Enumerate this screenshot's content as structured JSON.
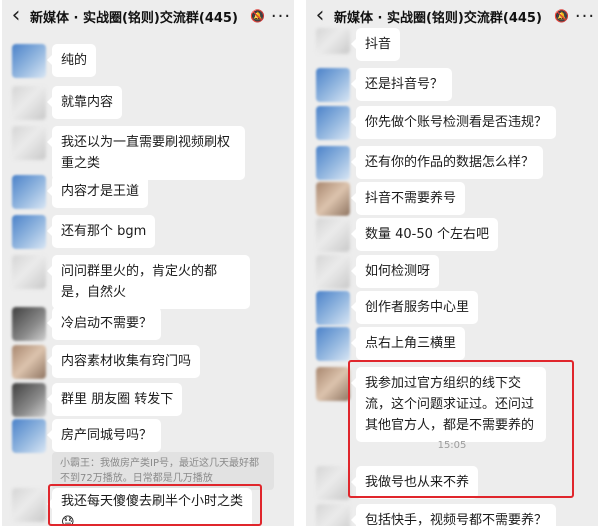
{
  "icons": {
    "back": "‹",
    "bell": "🔕",
    "more": "···"
  },
  "colors": {
    "highlight": "#e0262c",
    "chat_bg": "#ededed",
    "bubble": "#ffffff"
  },
  "left": {
    "title": "新媒体 · 实战圈(铭则)交流群(445)",
    "messages": [
      {
        "text": "纯的"
      },
      {
        "text": "就靠内容"
      },
      {
        "text": "我还以为一直需要刷视频刷权重之类"
      },
      {
        "text": "内容才是王道"
      },
      {
        "text": "还有那个 bgm"
      },
      {
        "text": "问问群里火的，肯定火的都是，自然火"
      },
      {
        "text": "冷启动不需要？"
      },
      {
        "text": "内容素材收集有窍门吗"
      },
      {
        "text": "群里 朋友圈 转发下"
      },
      {
        "text": "房产同城号吗？"
      },
      {
        "text": "我还每天傻傻去刷半个小时之类",
        "emoji": "😓"
      }
    ],
    "quote": "小霸王：我做房产类IP号，最近这几天最好都不到72万播放。日常都是几万播放"
  },
  "right": {
    "title": "新媒体 · 实战圈(铭则)交流群(445)",
    "messages": [
      {
        "text": "抖音"
      },
      {
        "text": "还是抖音号？"
      },
      {
        "text": "你先做个账号检测看是否违规？"
      },
      {
        "text": "还有你的作品的数据怎么样？"
      },
      {
        "text": "抖音不需要养号"
      },
      {
        "text": "数量 40-50 个左右吧"
      },
      {
        "text": "如何检测呀"
      },
      {
        "text": "创作者服务中心里"
      },
      {
        "text": "点右上角三横里"
      },
      {
        "text": "我参加过官方组织的线下交流，这个问题求证过。还问过其他官方人，都是不需要养的"
      },
      {
        "text": "我做号也从来不养"
      },
      {
        "text": "包括快手，视频号都不需要养？"
      }
    ],
    "time": "15:05"
  }
}
